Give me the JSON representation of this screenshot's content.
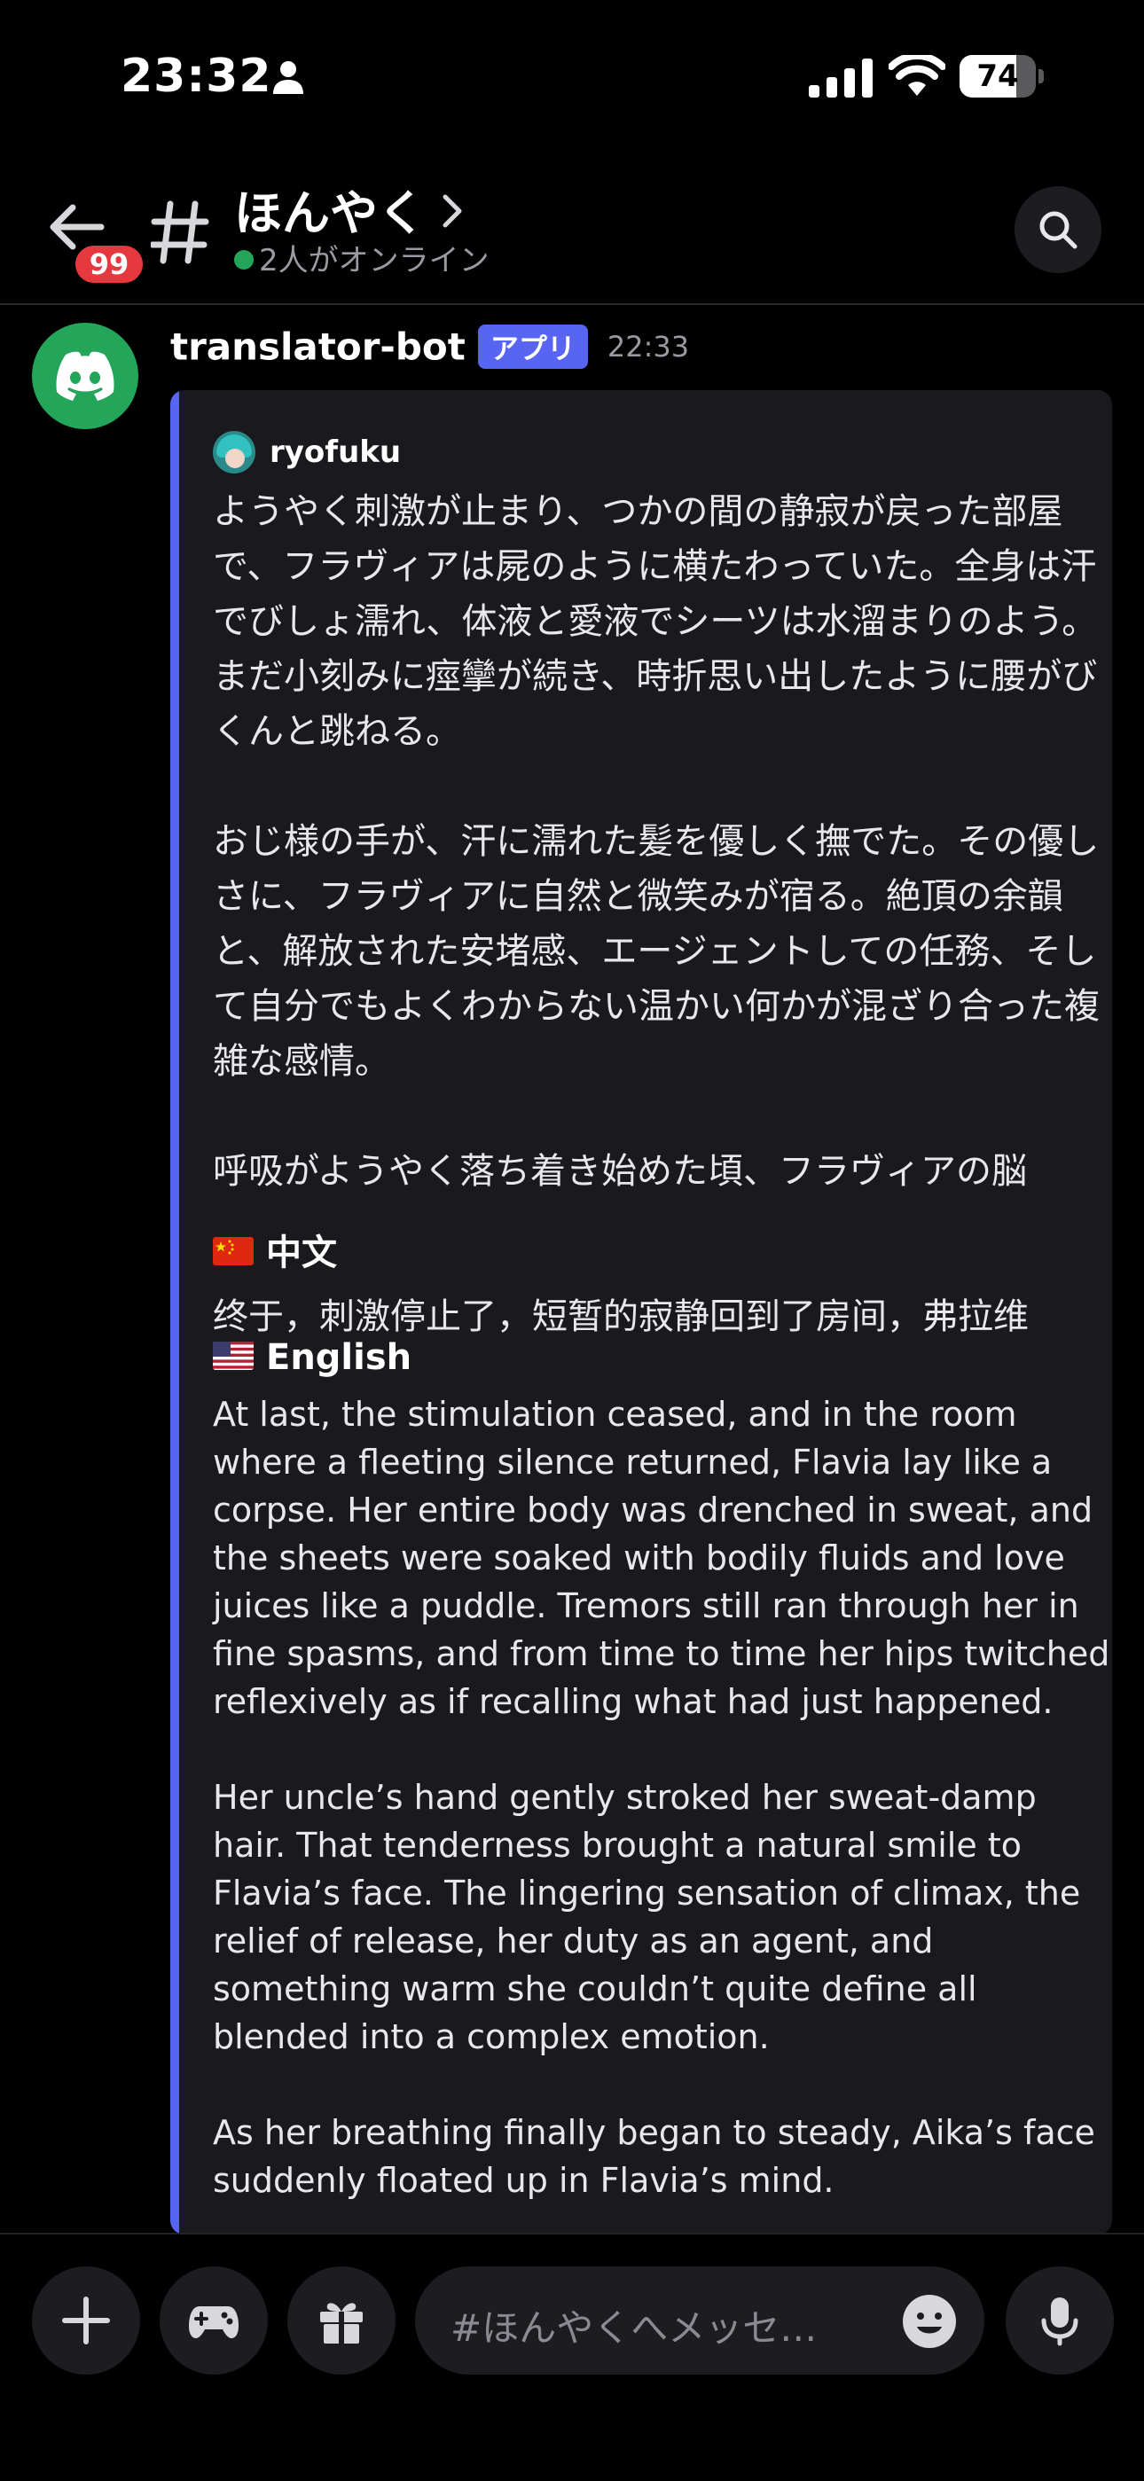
{
  "status_bar": {
    "time": "23:32",
    "battery": "74",
    "battery_level": 0.74
  },
  "header": {
    "notification_count": "99",
    "channel_name": "ほんやく",
    "online_status": "2人がオンライン"
  },
  "message": {
    "author": "translator-bot",
    "app_tag": "アプリ",
    "timestamp": "22:33",
    "embed": {
      "author": "ryofuku",
      "original_text": "ようやく刺激が止まり、つかの間の静寂が戻った部屋で、フラヴィアは屍のように横たわっていた。全身は汗でびしょ濡れ、体液と愛液でシーツは水溜まりのよう。まだ小刻みに痙攣が続き、時折思い出したように腰がびくんと跳ねる。\n\nおじ様の手が、汗に濡れた髪を優しく撫でた。その優しさに、フラヴィアに自然と微笑みが宿る。絶頂の余韻と、解放された安堵感、エージェントしての任務、そして自分でもよくわからない温かい何かが混ざり合った複雑な感情。\n\n呼吸がようやく落ち着き始めた頃、フラヴィアの脳",
      "chinese_label": "中文",
      "chinese_text": "终于，刺激停止了，短暂的寂静回到了房间，弗拉维",
      "english_label": "English",
      "english_text": "At last, the stimulation ceased, and in the room where a fleeting silence returned, Flavia lay like a corpse. Her entire body was drenched in sweat, and the sheets were soaked with bodily fluids and love juices like a puddle. Tremors still ran through her in fine spasms, and from time to time her hips twitched reflexively as if recalling what had just happened.\n\nHer uncle’s hand gently stroked her sweat-damp hair. That tenderness brought a natural smile to Flavia’s face. The lingering sensation of climax, the relief of release, her duty as an agent, and something warm she couldn’t quite define all blended into a complex emotion.\n\nAs her breathing finally began to steady, Aika’s face suddenly floated up in Flavia’s mind."
    }
  },
  "composer": {
    "placeholder": "#ほんやくへメッセ…"
  },
  "icons": {
    "person": "person-icon",
    "signal": "cellular-signal-icon",
    "wifi": "wifi-icon",
    "back": "back-arrow-icon",
    "hash": "hash-icon",
    "chevron": "chevron-right-icon",
    "search": "search-icon",
    "bot_avatar": "discord-logo-icon",
    "add": "plus-icon",
    "games": "gamepad-icon",
    "gift": "gift-icon",
    "emoji": "emoji-icon",
    "mic": "microphone-icon"
  },
  "colors": {
    "accent": "#5865f2",
    "online": "#23a55a",
    "badge": "#e5383f",
    "bot_avatar_bg": "#23a55a",
    "embed_bg": "#1a1a1e"
  }
}
